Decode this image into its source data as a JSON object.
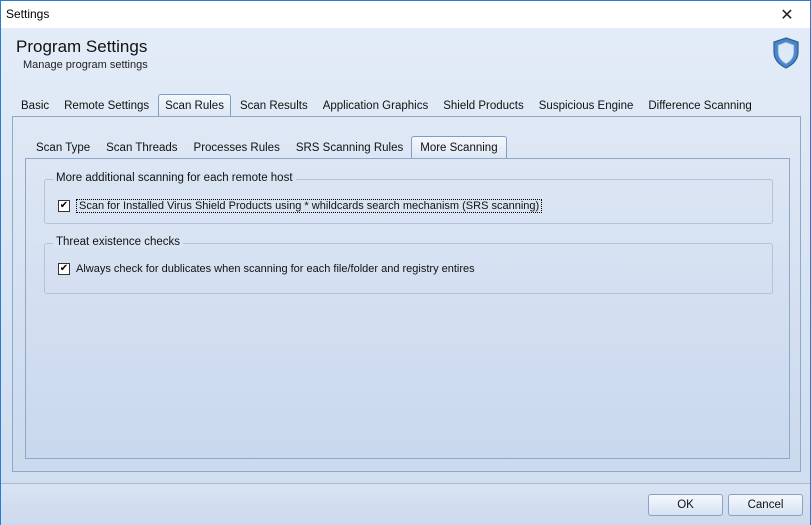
{
  "window": {
    "title": "Settings"
  },
  "header": {
    "title": "Program Settings",
    "subtitle": "Manage program settings"
  },
  "outer_tabs": [
    {
      "label": "Basic",
      "active": false
    },
    {
      "label": "Remote Settings",
      "active": false
    },
    {
      "label": "Scan Rules",
      "active": true
    },
    {
      "label": "Scan Results",
      "active": false
    },
    {
      "label": "Application Graphics",
      "active": false
    },
    {
      "label": "Shield Products",
      "active": false
    },
    {
      "label": "Suspicious Engine",
      "active": false
    },
    {
      "label": "Difference Scanning",
      "active": false
    }
  ],
  "inner_tabs": [
    {
      "label": "Scan Type",
      "active": false
    },
    {
      "label": "Scan Threads",
      "active": false
    },
    {
      "label": "Processes Rules",
      "active": false
    },
    {
      "label": "SRS Scanning Rules",
      "active": false
    },
    {
      "label": "More Scanning",
      "active": true
    }
  ],
  "groups": [
    {
      "label": "More additional scanning for each remote host",
      "checkbox": {
        "label": "Scan for Installed Virus Shield Products using * whildcards search mechanism (SRS scanning)",
        "checked": true
      }
    },
    {
      "label": "Threat existence checks",
      "checkbox": {
        "label": "Always check for dublicates when scanning for each file/folder and registry entires",
        "checked": true
      }
    }
  ],
  "buttons": {
    "ok": "OK",
    "cancel": "Cancel"
  },
  "icons": {
    "close": "close-icon",
    "brand": "shield-icon"
  },
  "colors": {
    "window_border": "#2b7bd3",
    "panel_bg": "#cbd9ee",
    "shield": "#4a86c8"
  }
}
